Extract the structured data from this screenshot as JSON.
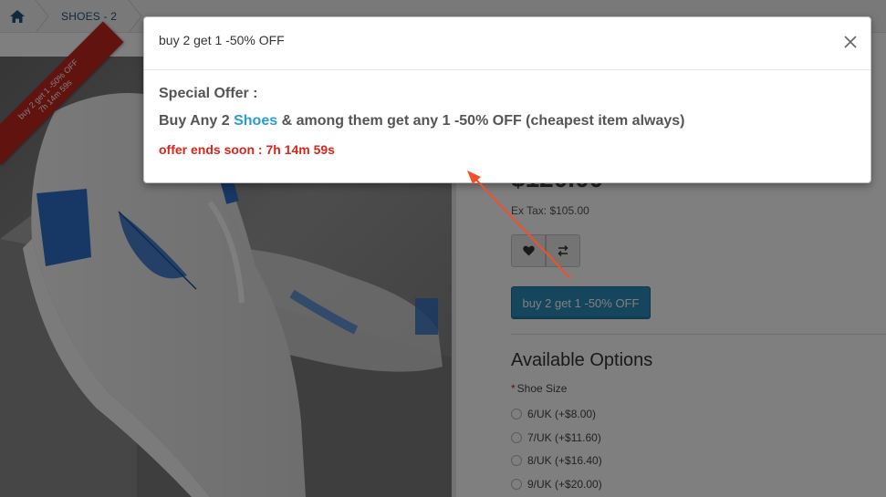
{
  "breadcrumb": {
    "home_icon": "home-icon",
    "item": "SHOES - 2"
  },
  "product": {
    "ribbon_line1": "buy 2 get 1 -50% OFF",
    "ribbon_line2": "7h 14m 59s",
    "price": "$120.00",
    "ex_tax": "Ex Tax: $105.00",
    "wishlist_icon": "heart-icon",
    "compare_icon": "exchange-icon",
    "offer_button": "buy 2 get 1 -50% OFF"
  },
  "options": {
    "title": "Available Options",
    "required_mark": "*",
    "shoe_size_label": "Shoe Size",
    "sizes": [
      "6/UK (+$8.00)",
      "7/UK (+$11.60)",
      "8/UK (+$16.40)",
      "9/UK (+$20.00)"
    ]
  },
  "modal": {
    "title": "buy 2 get 1 -50% OFF",
    "close_icon": "close-icon",
    "special_offer": "Special Offer :",
    "buy_prefix": "Buy Any 2",
    "shoes_link": "Shoes",
    "buy_suffix": "& among them get any 1 -50% OFF (cheapest item always)",
    "ends": "offer ends soon : 7h 14m 59s"
  },
  "colors": {
    "accent": "#2a8cbd",
    "link": "#2a9bd6",
    "alert": "#d8261a",
    "ribbon": "#c0261e",
    "annotation_arrow": "#f0502a"
  }
}
